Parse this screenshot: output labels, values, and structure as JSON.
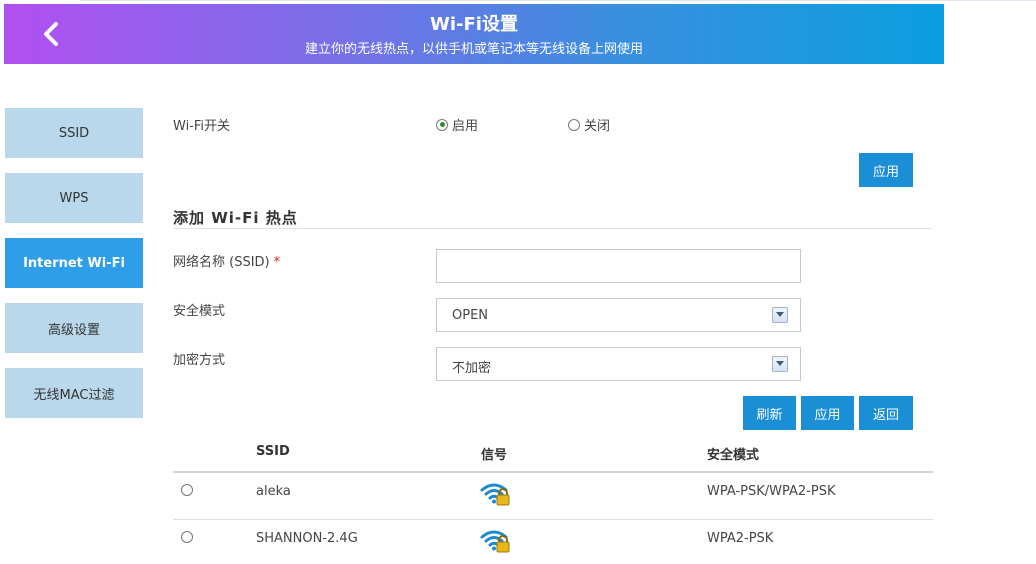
{
  "header": {
    "title": "Wi-Fi设置",
    "subtitle": "建立你的无线热点，以供手机或笔记本等无线设备上网使用",
    "back_icon": "chevron-left-icon"
  },
  "sidebar": {
    "items": [
      {
        "label": "SSID",
        "active": false
      },
      {
        "label": "WPS",
        "active": false
      },
      {
        "label": "Internet Wi-Fi",
        "active": true
      },
      {
        "label": "高级设置",
        "active": false
      },
      {
        "label": "无线MAC过滤",
        "active": false
      }
    ]
  },
  "wifi_switch": {
    "label": "Wi-Fi开关",
    "enable_label": "启用",
    "disable_label": "关闭",
    "selected": "启用",
    "apply_label": "应用"
  },
  "add_hotspot": {
    "title": "添加 Wi-Fi 热点",
    "ssid_label": "网络名称 (SSID)",
    "required_mark": "*",
    "ssid_value": "",
    "security_label": "安全模式",
    "security_value": "OPEN",
    "encryption_label": "加密方式",
    "encryption_value": "不加密",
    "refresh_label": "刷新",
    "apply_label": "应用",
    "back_label": "返回"
  },
  "network_table": {
    "columns": [
      "SSID",
      "信号",
      "安全模式"
    ],
    "rows": [
      {
        "ssid": "aleka",
        "signal_icon": "wifi-lock-icon",
        "security": "WPA-PSK/WPA2-PSK"
      },
      {
        "ssid": "SHANNON-2.4G",
        "signal_icon": "wifi-lock-icon",
        "security": "WPA2-PSK"
      }
    ]
  },
  "colors": {
    "accent": "#1a8fd6",
    "sidebar_bg": "#b9d8eb",
    "sidebar_active": "#2e9ee8",
    "header_gradient_start": "#b150f0",
    "header_gradient_end": "#0a9ee0"
  }
}
